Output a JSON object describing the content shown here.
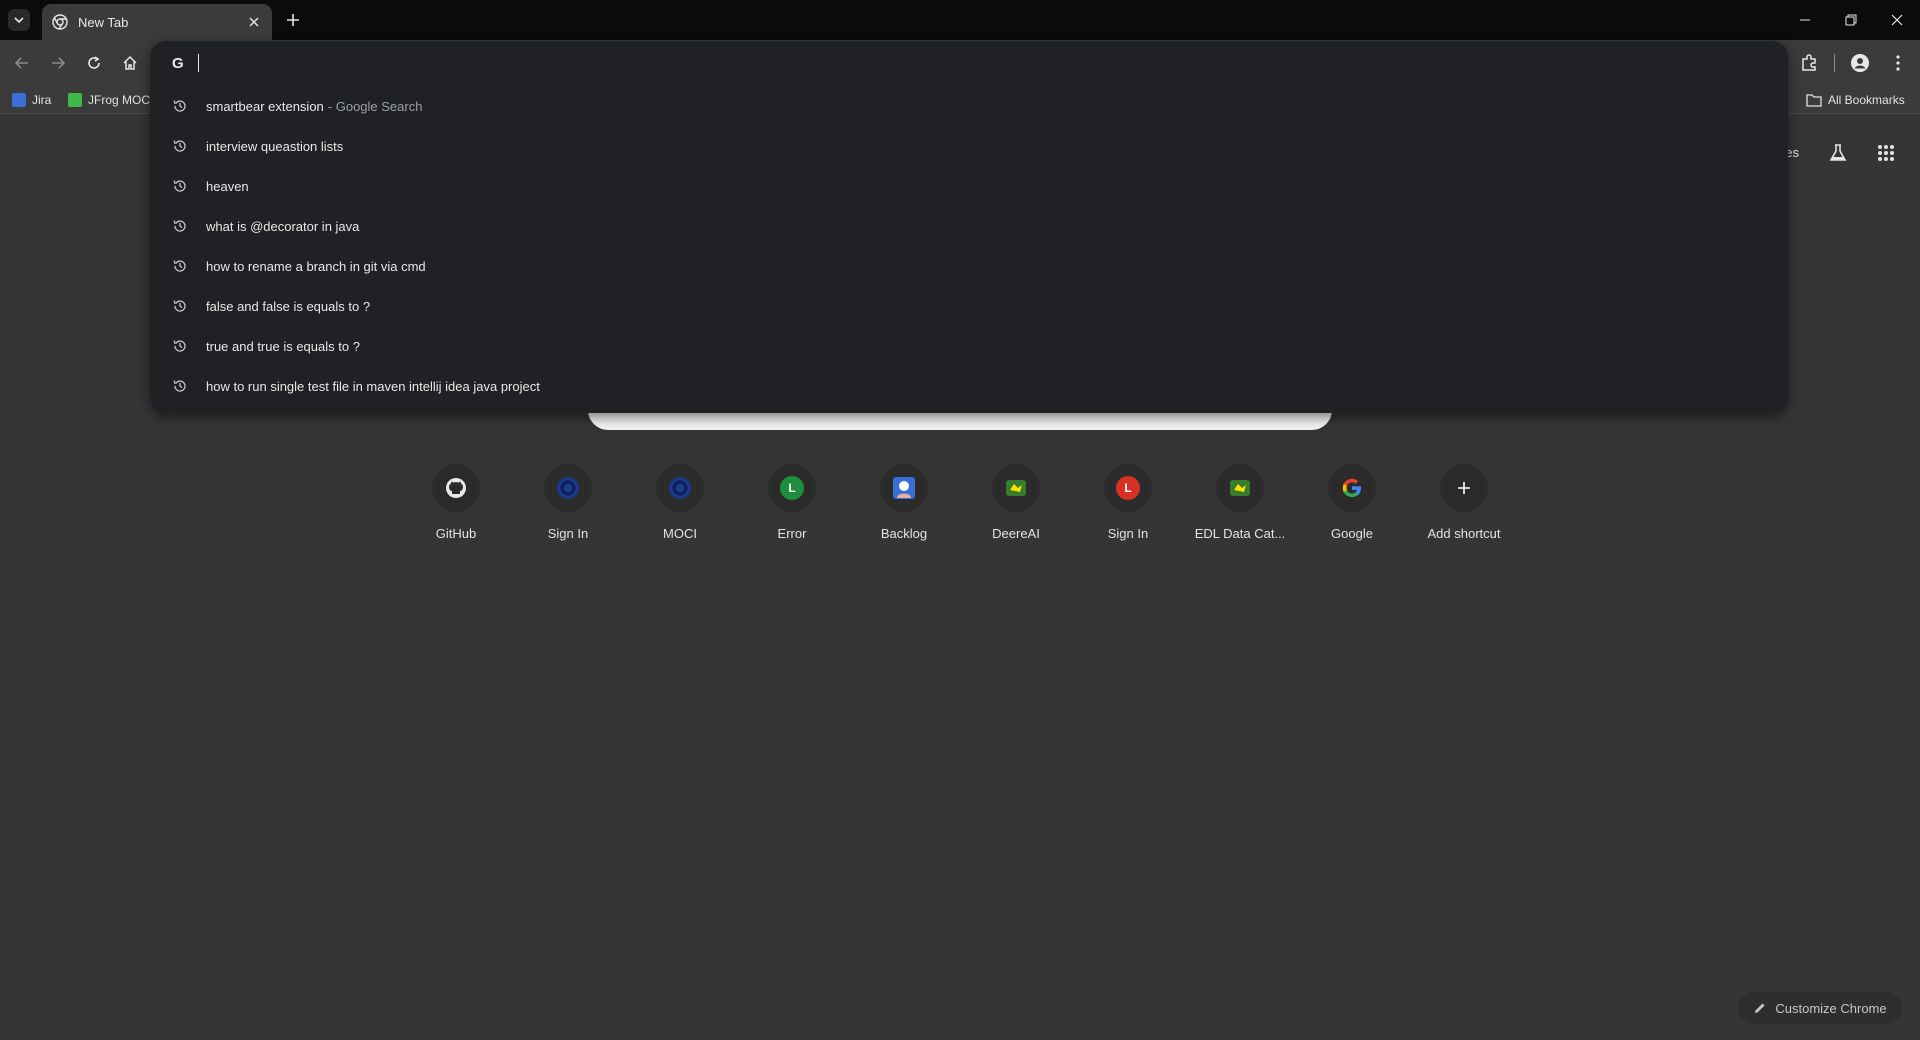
{
  "tabstrip": {
    "tab_title": "New Tab"
  },
  "bookmarks": {
    "items": [
      {
        "label": "Jira"
      },
      {
        "label": "JFrog MOC"
      }
    ],
    "all_bookmarks": "All Bookmarks"
  },
  "omnibox": {
    "input_value": "",
    "suggestions": [
      {
        "text": "smartbear extension",
        "sub": "- Google Search"
      },
      {
        "text": "interview queastion lists",
        "sub": ""
      },
      {
        "text": "heaven",
        "sub": ""
      },
      {
        "text": "what is @decorator in java",
        "sub": ""
      },
      {
        "text": "how to rename a branch in git via cmd",
        "sub": ""
      },
      {
        "text": "false and false is equals to ?",
        "sub": ""
      },
      {
        "text": "true and true is equals to ?",
        "sub": ""
      },
      {
        "text": "how to run single test file in maven intellij idea java project",
        "sub": ""
      }
    ]
  },
  "ntp": {
    "images_link": "ges",
    "shortcuts": [
      {
        "label": "GitHub",
        "icon": "github-icon"
      },
      {
        "label": "Sign In",
        "icon": "sign-in-icon"
      },
      {
        "label": "MOCI",
        "icon": "moci-icon"
      },
      {
        "label": "Error",
        "icon": "error-icon",
        "letter": "L"
      },
      {
        "label": "Backlog",
        "icon": "backlog-icon"
      },
      {
        "label": "DeereAI",
        "icon": "deere-icon"
      },
      {
        "label": "Sign In",
        "icon": "sign-in-l-icon",
        "letter": "L"
      },
      {
        "label": "EDL Data Cat...",
        "icon": "deere-icon"
      },
      {
        "label": "Google",
        "icon": "google-icon"
      },
      {
        "label": "Add shortcut",
        "icon": "plus-icon"
      }
    ],
    "customize_label": "Customize Chrome"
  },
  "colors": {
    "tabstrip_bg": "#0b0b0b",
    "toolbar_bg": "#3b3b3b",
    "ntp_bg": "#353535",
    "omnibox_bg": "#202124",
    "error_green": "#1e8e3e",
    "sign_in_red": "#d93025",
    "deere_green": "#367c2b",
    "moci_blue": "#1a3a8a"
  }
}
